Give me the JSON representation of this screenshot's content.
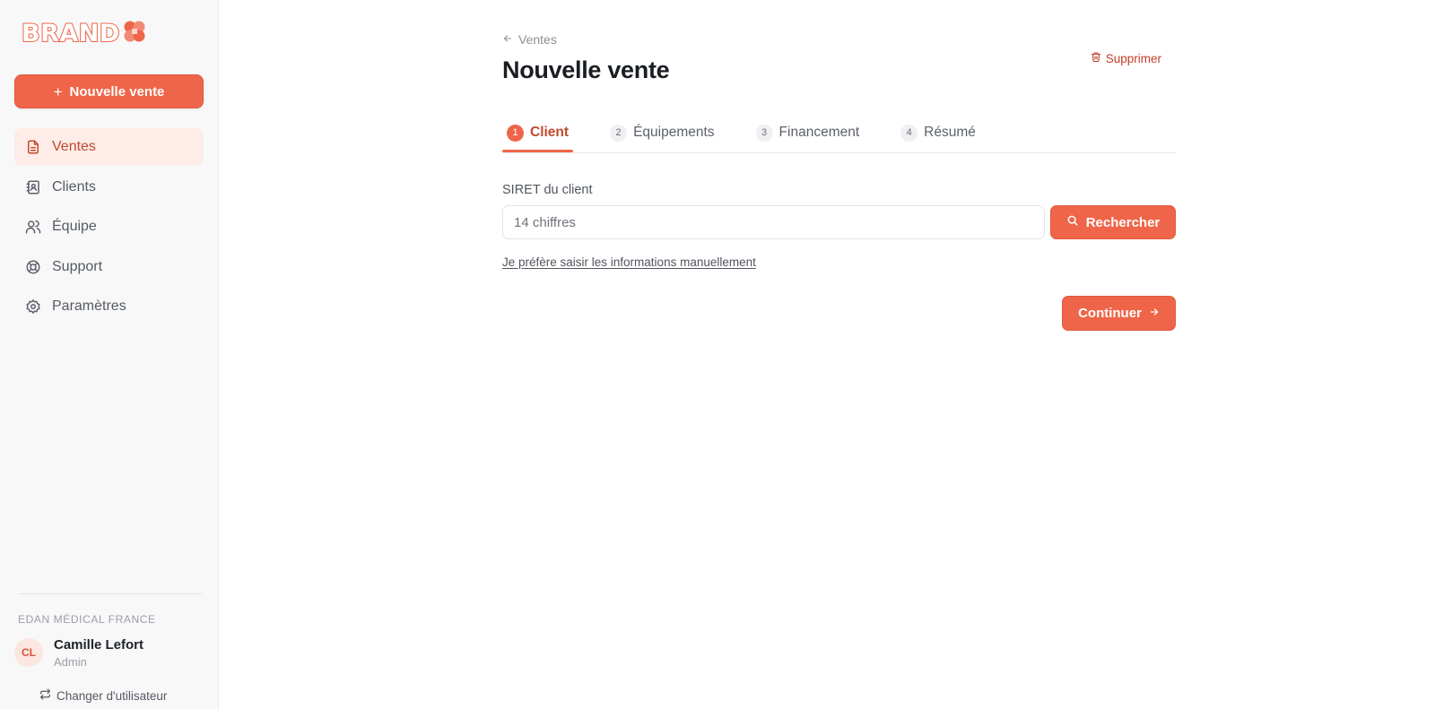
{
  "brand": {
    "logo_text": "BRAND",
    "accent_color": "#ef6549"
  },
  "sidebar": {
    "new_sale_label": "Nouvelle vente",
    "items": [
      {
        "label": "Ventes",
        "icon": "document-icon",
        "active": true
      },
      {
        "label": "Clients",
        "icon": "contacts-book-icon",
        "active": false
      },
      {
        "label": "Équipe",
        "icon": "users-icon",
        "active": false
      },
      {
        "label": "Support",
        "icon": "lifebuoy-icon",
        "active": false
      },
      {
        "label": "Paramètres",
        "icon": "gear-icon",
        "active": false
      }
    ],
    "organization": "EDAN MÉDICAL FRANCE",
    "user": {
      "initials": "CL",
      "name": "Camille Lefort",
      "role": "Admin"
    },
    "switch_user_label": "Changer d'utilisateur"
  },
  "main": {
    "back_label": "Ventes",
    "title": "Nouvelle vente",
    "delete_label": "Supprimer",
    "tabs": [
      {
        "number": "1",
        "label": "Client",
        "active": true
      },
      {
        "number": "2",
        "label": "Équipements",
        "active": false
      },
      {
        "number": "3",
        "label": "Financement",
        "active": false
      },
      {
        "number": "4",
        "label": "Résumé",
        "active": false
      }
    ],
    "siret": {
      "label": "SIRET du client",
      "placeholder": "14 chiffres",
      "value": ""
    },
    "search_label": "Rechercher",
    "manual_link": "Je préfère saisir les informations manuellement",
    "continue_label": "Continuer"
  }
}
